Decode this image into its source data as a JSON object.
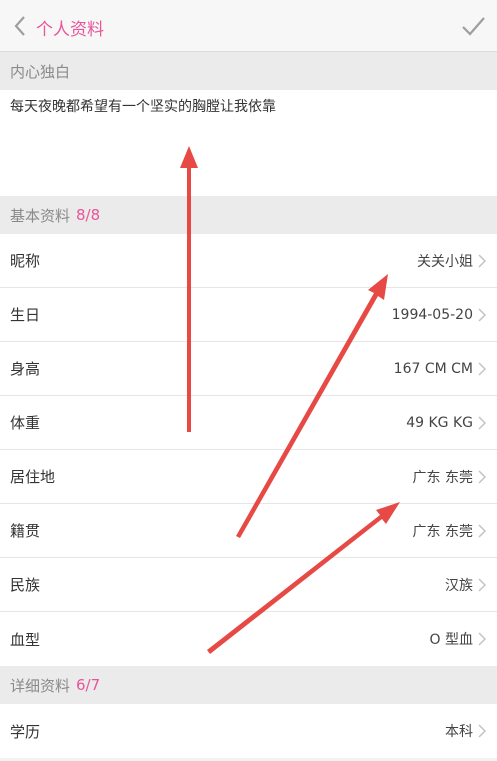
{
  "header": {
    "title": "个人资料"
  },
  "intro": {
    "section_title": "内心独白",
    "text": "每天夜晚都希望有一个坚实的胸膛让我依靠"
  },
  "basic": {
    "section_title": "基本资料",
    "count": "8/8",
    "rows": [
      {
        "label": "昵称",
        "value": "关关小姐"
      },
      {
        "label": "生日",
        "value": "1994-05-20"
      },
      {
        "label": "身高",
        "value": "167 CM CM"
      },
      {
        "label": "体重",
        "value": "49 KG KG"
      },
      {
        "label": "居住地",
        "value": "广东 东莞"
      },
      {
        "label": "籍贯",
        "value": "广东 东莞"
      },
      {
        "label": "民族",
        "value": "汉族"
      },
      {
        "label": "血型",
        "value": "O 型血"
      }
    ]
  },
  "detail": {
    "section_title": "详细资料",
    "count": "6/7",
    "rows": [
      {
        "label": "学历",
        "value": "本科"
      }
    ]
  },
  "colors": {
    "accent": "#e8559a",
    "annotation_arrow": "#e53935"
  },
  "icons": {
    "back": "chevron-left-icon",
    "confirm": "checkmark-icon",
    "row": "chevron-right-icon"
  }
}
